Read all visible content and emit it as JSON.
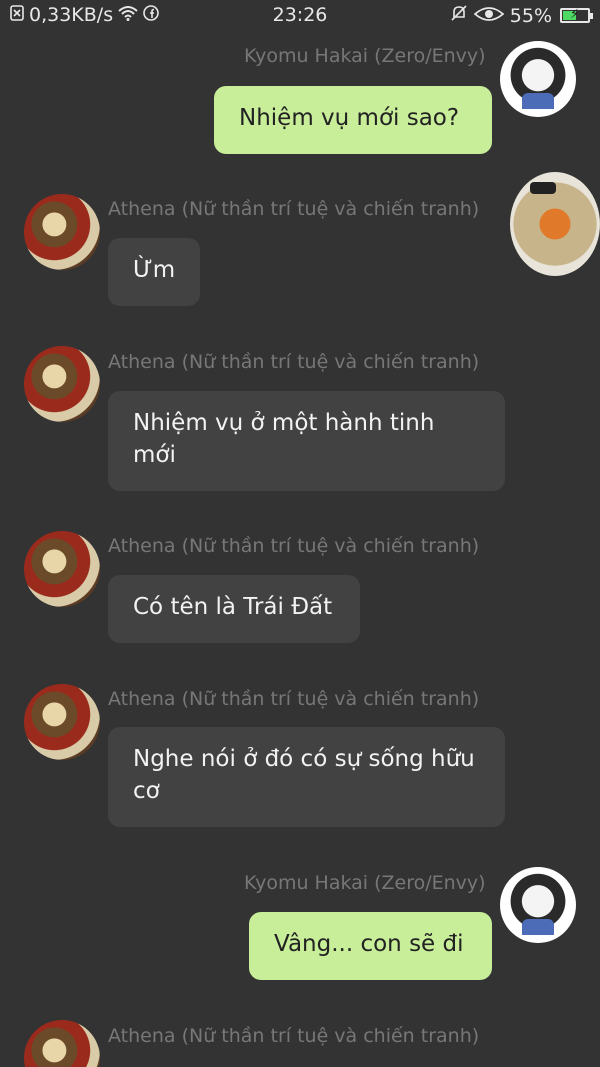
{
  "status_bar": {
    "network_speed": "0,33KB/s",
    "time": "23:26",
    "battery_percent": "55%",
    "battery_level": 0.55,
    "icons": [
      "close-box-icon",
      "wifi-icon",
      "facebook-icon",
      "bell-muted-icon",
      "eye-icon",
      "battery-charging-icon"
    ]
  },
  "messages": [
    {
      "sender": "Kyomu Hakai (Zero/Envy)",
      "text": "Nhiệm vụ mới sao?",
      "direction": "out"
    },
    {
      "sender": "Athena (Nữ thần trí tuệ và chiến tranh)",
      "text": "Ừm",
      "direction": "in"
    },
    {
      "sender": "Athena (Nữ thần trí tuệ và chiến tranh)",
      "text": "Nhiệm vụ ở một hành tinh mới",
      "direction": "in"
    },
    {
      "sender": "Athena (Nữ thần trí tuệ và chiến tranh)",
      "text": "Có tên là Trái Đất",
      "direction": "in"
    },
    {
      "sender": "Athena (Nữ thần trí tuệ và chiến tranh)",
      "text": "Nghe nói ở đó có sự sống hữu cơ",
      "direction": "in"
    },
    {
      "sender": "Kyomu Hakai (Zero/Envy)",
      "text": "Vâng... con sẽ đi",
      "direction": "out"
    },
    {
      "sender": "Athena (Nữ thần trí tuệ và chiến tranh)",
      "text": "",
      "direction": "in"
    }
  ],
  "colors": {
    "background": "#333333",
    "outgoing_bubble": "#c8ee9a",
    "incoming_bubble": "#424242",
    "sender_name": "#777777",
    "battery_fill": "#4cd964"
  }
}
